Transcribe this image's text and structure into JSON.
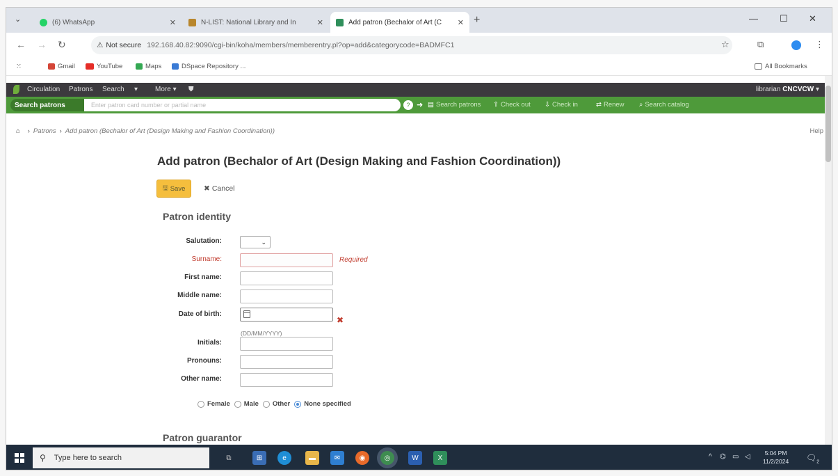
{
  "browser": {
    "tabs": [
      {
        "title": "(6) WhatsApp",
        "color": "#25d366"
      },
      {
        "title": "N-LIST: National Library and In",
        "color": "#b8862c"
      },
      {
        "title": "Add patron (Bechalor of Art (C",
        "color": "#2f8f5b"
      }
    ],
    "security_label": "Not secure",
    "url": "192.168.40.82:9090/cgi-bin/koha/members/memberentry.pl?op=add&categorycode=BADMFC1",
    "bookmarks": [
      {
        "label": "Gmail",
        "color": "#d44638"
      },
      {
        "label": "YouTube",
        "color": "#e52d27"
      },
      {
        "label": "Maps",
        "color": "#34a853"
      },
      {
        "label": "DSpace Repository ...",
        "color": "#3a7bd5"
      }
    ],
    "all_bookmarks": "All Bookmarks"
  },
  "koha_nav": {
    "items": [
      "Circulation",
      "Patrons",
      "Search",
      "More"
    ],
    "library_prefix": "librarian",
    "library_name": "CNCVCW"
  },
  "search_bar": {
    "label": "Search patrons",
    "placeholder": "Enter patron card number or partial name",
    "quick_links": [
      "Search patrons",
      "Check out",
      "Check in",
      "Renew",
      "Search catalog"
    ]
  },
  "breadcrumb": {
    "items": [
      "Patrons",
      "Add patron (Bechalor of Art (Design Making and Fashion Coordination))"
    ],
    "help": "Help"
  },
  "page": {
    "title": "Add patron (Bechalor of Art (Design Making and Fashion Coordination))",
    "save_label": "Save",
    "cancel_label": "Cancel"
  },
  "patron_identity": {
    "heading": "Patron identity",
    "salutation_label": "Salutation:",
    "surname_label": "Surname:",
    "required_text": "Required",
    "firstname_label": "First name:",
    "middlename_label": "Middle name:",
    "dob_label": "Date of birth:",
    "dob_format": "(DD/MM/YYYY)",
    "initials_label": "Initials:",
    "pronouns_label": "Pronouns:",
    "othername_label": "Other name:",
    "gender_options": [
      "Female",
      "Male",
      "Other",
      "None specified"
    ],
    "gender_selected": "None specified"
  },
  "patron_guarantor": {
    "heading": "Patron guarantor"
  },
  "taskbar": {
    "search_placeholder": "Type here to search",
    "time": "5:04 PM",
    "date": "11/2/2024",
    "notification_count": "2"
  }
}
